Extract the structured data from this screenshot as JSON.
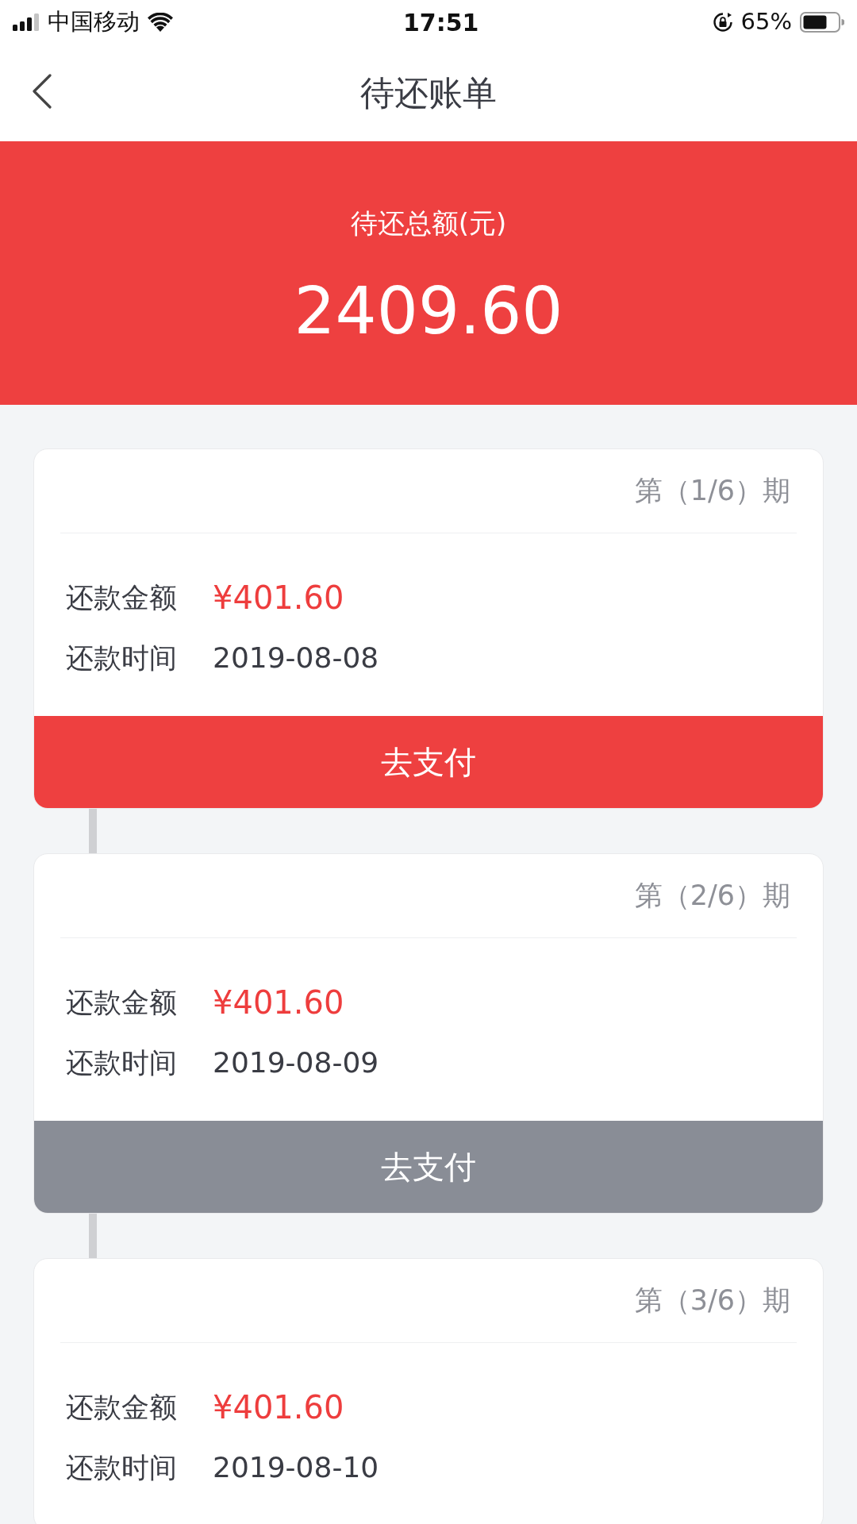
{
  "status_bar": {
    "carrier": "中国移动",
    "time": "17:51",
    "battery": "65%"
  },
  "nav": {
    "title": "待还账单"
  },
  "summary": {
    "label": "待还总额(元)",
    "amount": "2409.60"
  },
  "installments": [
    {
      "period": "第（1/6）期",
      "rows": [
        {
          "kind": "amount",
          "label": "还款金额",
          "value": "¥401.60"
        },
        {
          "kind": "date",
          "label": "还款时间",
          "value": "2019-08-08"
        }
      ],
      "button": {
        "label": "去支付",
        "disabled": false
      }
    },
    {
      "period": "第（2/6）期",
      "rows": [
        {
          "kind": "amount",
          "label": "还款金额",
          "value": "¥401.60"
        },
        {
          "kind": "date",
          "label": "还款时间",
          "value": "2019-08-09"
        }
      ],
      "button": {
        "label": "去支付",
        "disabled": true
      }
    },
    {
      "period": "第（3/6）期",
      "rows": [
        {
          "kind": "amount",
          "label": "还款金额",
          "value": "¥401.60"
        },
        {
          "kind": "date",
          "label": "还款时间",
          "value": "2019-08-10"
        }
      ]
    }
  ]
}
